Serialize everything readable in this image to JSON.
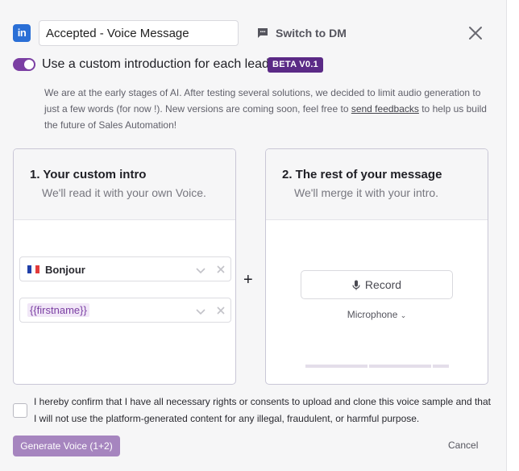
{
  "header": {
    "logo_text": "in",
    "title_value": "Accepted - Voice Message",
    "switch_label": "Switch to DM"
  },
  "intro": {
    "toggle_on": true,
    "label": "Use a custom introduction for each lead",
    "badge": "BETA V0.1",
    "info_before": "We are at the early stages of AI. After testing several solutions, we decided to limit audio generation to just a few words (for now !). New versions are coming soon, feel free to ",
    "info_link": "send feedbacks",
    "info_after": " to help us build the future of Sales Automation!"
  },
  "left_card": {
    "title": "1. Your custom intro",
    "subtitle": "We'll read it with your own Voice.",
    "fields": [
      {
        "type": "flag",
        "value": "Bonjour"
      },
      {
        "type": "variable",
        "value": "{{firstname}}"
      }
    ]
  },
  "plus_sign": "+",
  "right_card": {
    "title": "2. The rest of your message",
    "subtitle": "We'll merge it with your intro.",
    "record_label": "Record",
    "mic_label": "Microphone"
  },
  "consent": {
    "text": "I hereby confirm that I have all necessary rights or consents to upload and clone this voice sample and that I will not use the platform-generated content for any illegal, fraudulent, or harmful purpose.",
    "checked": false
  },
  "footer": {
    "generate_label": "Generate Voice (1+2)",
    "cancel_label": "Cancel"
  },
  "colors": {
    "accent": "#7b3fa3",
    "badge": "#5b2a86",
    "linkedin": "#2a6fd6",
    "generate_button": "#a685bf"
  }
}
